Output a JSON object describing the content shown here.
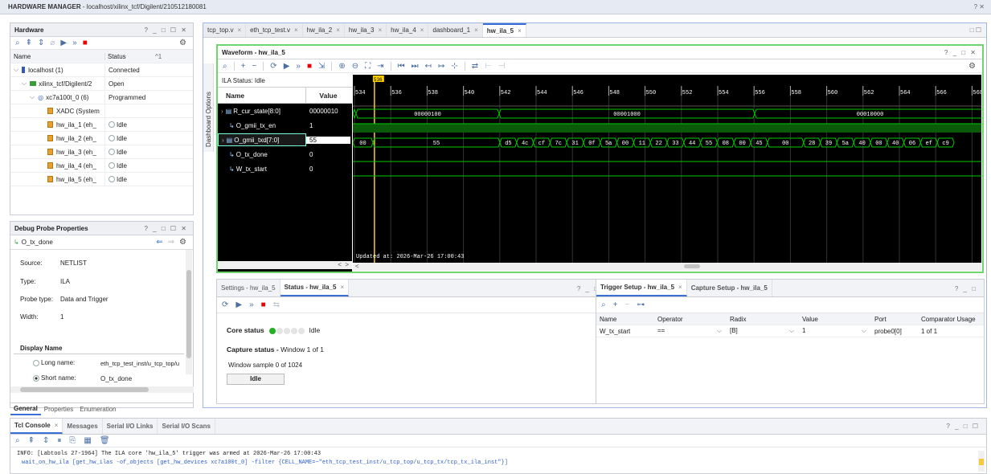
{
  "app": {
    "title_bold": "HARDWARE MANAGER",
    "title_rest": " - localhost/xilinx_tcf/Digilent/210512180081",
    "help": "? ✕"
  },
  "hardware": {
    "title": "Hardware",
    "controls": "? _ □ ☐ ✕",
    "col_name": "Name",
    "col_status": "Status",
    "sort": "^1",
    "rows": [
      {
        "name": "localhost (1)",
        "status": "Connected"
      },
      {
        "name": "xilinx_tcf/Digilent/2",
        "status": "Open"
      },
      {
        "name": "xc7a100t_0 (6)",
        "status": "Programmed"
      },
      {
        "name": "XADC (System",
        "status": ""
      },
      {
        "name": "hw_ila_1 (eh_",
        "status": "Idle"
      },
      {
        "name": "hw_ila_2 (eh_",
        "status": "Idle"
      },
      {
        "name": "hw_ila_3 (eh_",
        "status": "Idle"
      },
      {
        "name": "hw_ila_4 (eh_",
        "status": "Idle"
      },
      {
        "name": "hw_ila_5 (eh_",
        "status": "Idle"
      }
    ]
  },
  "probe_props": {
    "title": "Debug Probe Properties",
    "controls": "? _ □ ☐ ✕",
    "probe": "O_tx_done",
    "source_label": "Source:",
    "source": "NETLIST",
    "type_label": "Type:",
    "type": "ILA",
    "ptype_label": "Probe type:",
    "ptype": "Data and Trigger",
    "width_label": "Width:",
    "width": "1",
    "display_name": "Display Name",
    "long_label": "Long name:",
    "long_value": "eth_tcp_test_inst/u_tcp_top/u",
    "short_label": "Short name:",
    "short_value": "O_tx_done",
    "tabs": [
      "General",
      "Properties",
      "Enumeration"
    ]
  },
  "editor_tabs": [
    {
      "label": "tcp_top.v"
    },
    {
      "label": "eth_tcp_test.v"
    },
    {
      "label": "hw_ila_2"
    },
    {
      "label": "hw_ila_3"
    },
    {
      "label": "hw_ila_4"
    },
    {
      "label": "dashboard_1"
    },
    {
      "label": "hw_ila_5"
    }
  ],
  "side_label": "Dashboard Options",
  "waveform": {
    "title": "Waveform - hw_ila_5",
    "controls": "? _ □ ✕",
    "ila_status": "ILA Status: Idle",
    "col_name": "Name",
    "col_value": "Value",
    "signals": [
      {
        "name": "R_cur_state[8:0]",
        "value": "00000010"
      },
      {
        "name": "O_gmii_tx_en",
        "value": "1"
      },
      {
        "name": "O_gmii_txd[7:0]",
        "value": "55"
      },
      {
        "name": "O_tx_done",
        "value": "0"
      },
      {
        "name": "W_tx_start",
        "value": "0"
      }
    ],
    "marker": "536",
    "ticks": [
      "534",
      "536",
      "538",
      "540",
      "542",
      "544",
      "546",
      "548",
      "550",
      "552",
      "554",
      "556",
      "558",
      "560",
      "562",
      "564",
      "566",
      "568"
    ],
    "state_values": [
      "00000100",
      "00001000",
      "00010000"
    ],
    "txd_values": [
      "00",
      "55",
      "d5",
      "4c",
      "cf",
      "7c",
      "31",
      "0f",
      "5a",
      "00",
      "11",
      "22",
      "33",
      "44",
      "55",
      "08",
      "00",
      "45",
      "00",
      "28",
      "39",
      "5a",
      "40",
      "00",
      "40",
      "06",
      "ef",
      "c9"
    ],
    "updated": "Updated at: 2026-Mar-26 17:00:43"
  },
  "status_panel": {
    "tab1": "Settings - hw_ila_5",
    "tab2": "Status - hw_ila_5",
    "controls": "? _ □",
    "core_status_label": "Core status",
    "core_status": "Idle",
    "capture_label": "Capture status -",
    "capture_value": "Window 1 of 1",
    "window_sample": "Window sample 0 of 1024",
    "idle_btn": "Idle"
  },
  "trigger_panel": {
    "tab1": "Trigger Setup - hw_ila_5",
    "tab2": "Capture Setup - hw_ila_5",
    "controls": "? _ □",
    "cols": [
      "Name",
      "Operator",
      "Radix",
      "Value",
      "Port",
      "Comparator Usage"
    ],
    "row": [
      "W_tx_start",
      "==",
      "[B]",
      "1",
      "probe0[0]",
      "1 of 1"
    ]
  },
  "console": {
    "tabs": [
      "Tcl Console",
      "Messages",
      "Serial I/O Links",
      "Serial I/O Scans"
    ],
    "controls": "? _ □ ☐",
    "lines": [
      "INFO: [Labtools 27-1964] The ILA core 'hw_ila_5' trigger was armed at 2026-Mar-26 17:00:43",
      "wait_on_hw_ila [get_hw_ilas -of_objects [get_hw_devices xc7a100t_0] -filter {CELL_NAME=~\"eth_tcp_test_inst/u_tcp_top/u_tcp_tx/tcp_tx_ila_inst\"}]"
    ]
  },
  "colors": {
    "accent": "#3a6fd8",
    "wave_green": "#00c800",
    "marker": "#ffd000",
    "run": "#2e59c3",
    "stop": "#e00000"
  }
}
